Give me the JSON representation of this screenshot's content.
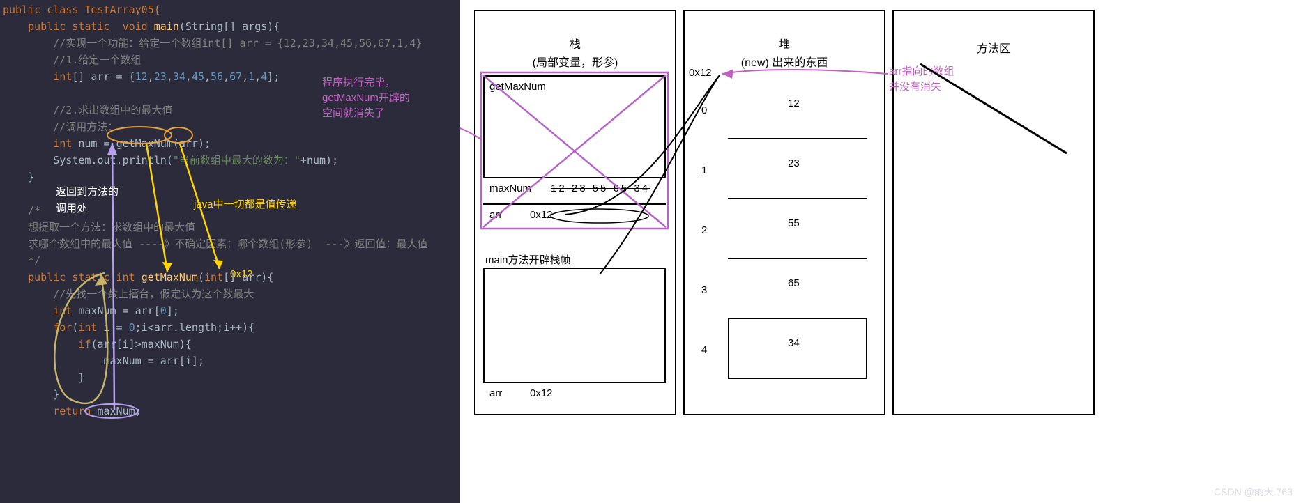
{
  "code": {
    "class_decl": "public class TestArray05{",
    "main_decl_kw": "public static  void",
    "main_decl_name": "main",
    "main_decl_params": "(String[] args){",
    "c1": "//实现一个功能：给定一个数组int[] arr = {12,23,34,45,56,67,1,4}",
    "c2": "//1.给定一个数组",
    "arr_decl": "int[] arr = {12,23,34,45,56,67,1,4};",
    "c3": "//2.求出数组中的最大值",
    "c4": "//调用方法：",
    "call_left": "int num = ",
    "call_fn": "getMaxNum",
    "call_right": "(arr);",
    "sout": "System.out.println(\"当前数组中最大的数为：\"+num);",
    "ret_note1": "返回到方法的",
    "ret_note2": "调用处",
    "yellow_note": "java中一切都是值传递",
    "hex": "0x12",
    "c5_l1": "/*",
    "c5_l2": "想提取一个方法：求数组中的最大值",
    "c5_l3": "求哪个数组中的最大值 ----》不确定因素：哪个数组(形参)  ---》返回值：最大值",
    "c5_l4": "*/",
    "fn_decl_kw": "public static int",
    "fn_decl_name": "getMaxNum",
    "fn_decl_params": "(int[] arr){",
    "c6": "//先找一个数上擂台，假定认为这个数最大",
    "maxnum_decl": "int maxNum = arr[0];",
    "for_line": "for(int i = 0;i<arr.length;i++){",
    "if_line": "if(arr[i]>maxNum){",
    "assign_line": "maxNum = arr[i];",
    "ret_line": "return maxNum;"
  },
  "annotations": {
    "purple1": "程序执行完毕，",
    "purple2": "getMaxNum开辟的",
    "purple3": "空间就消失了",
    "purple_right1": "arr指向的数组",
    "purple_right2": "并没有消失"
  },
  "stack": {
    "title": "栈",
    "subtitle": "(局部变量，形参)",
    "frame_top": "getMaxNum",
    "maxNum_label": "maxNum",
    "maxNum_crossed": "12 23 55 65 34",
    "arr_label": "arr",
    "arr_val": "0x12",
    "main_title": "main方法开辟栈帧",
    "main_arr_label": "arr",
    "main_arr_val": "0x12"
  },
  "heap": {
    "title": "堆",
    "subtitle": "(new) 出来的东西",
    "address": "0x12",
    "indices": [
      "0",
      "1",
      "2",
      "3",
      "4"
    ],
    "values": [
      "12",
      "23",
      "55",
      "65",
      "34"
    ]
  },
  "method_area": {
    "title": "方法区"
  },
  "watermark": "CSDN @雨天.763"
}
